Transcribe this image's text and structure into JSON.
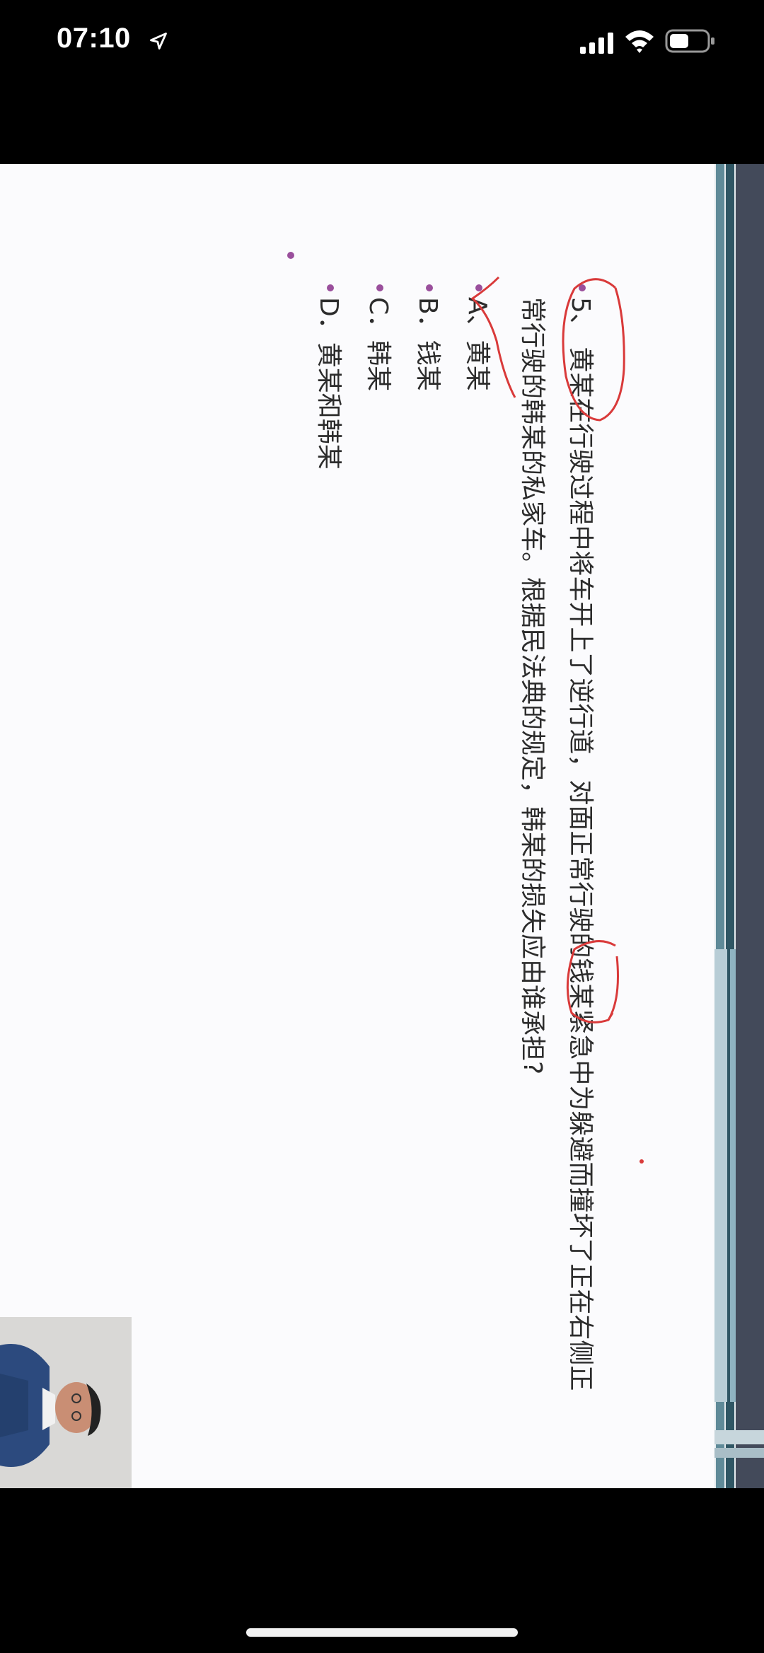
{
  "status_bar": {
    "time": "07:10",
    "icons": [
      "location-arrow-icon",
      "cellular-signal-icon",
      "wifi-icon",
      "battery-icon"
    ]
  },
  "slide": {
    "question_line1": "5、 黄某在行驶过程中将车开上了逆行道，对面正常行驶的钱某紧急中为躲避而撞坏了正在右侧正",
    "question_line2": "常行驶的韩某的私家车。根据民法典的规定，韩某的损失应由谁承担?",
    "options": [
      {
        "label": "A、黄某"
      },
      {
        "label": "B．钱某"
      },
      {
        "label": "C．韩某"
      },
      {
        "label": "D．黄某和韩某"
      }
    ]
  },
  "colors": {
    "bullet": "#9a4f9c",
    "annotation": "#d93a3a",
    "band_dark": "#434a5a",
    "band_teal": "#5f8a98",
    "band_light": "#b8cdd6"
  }
}
